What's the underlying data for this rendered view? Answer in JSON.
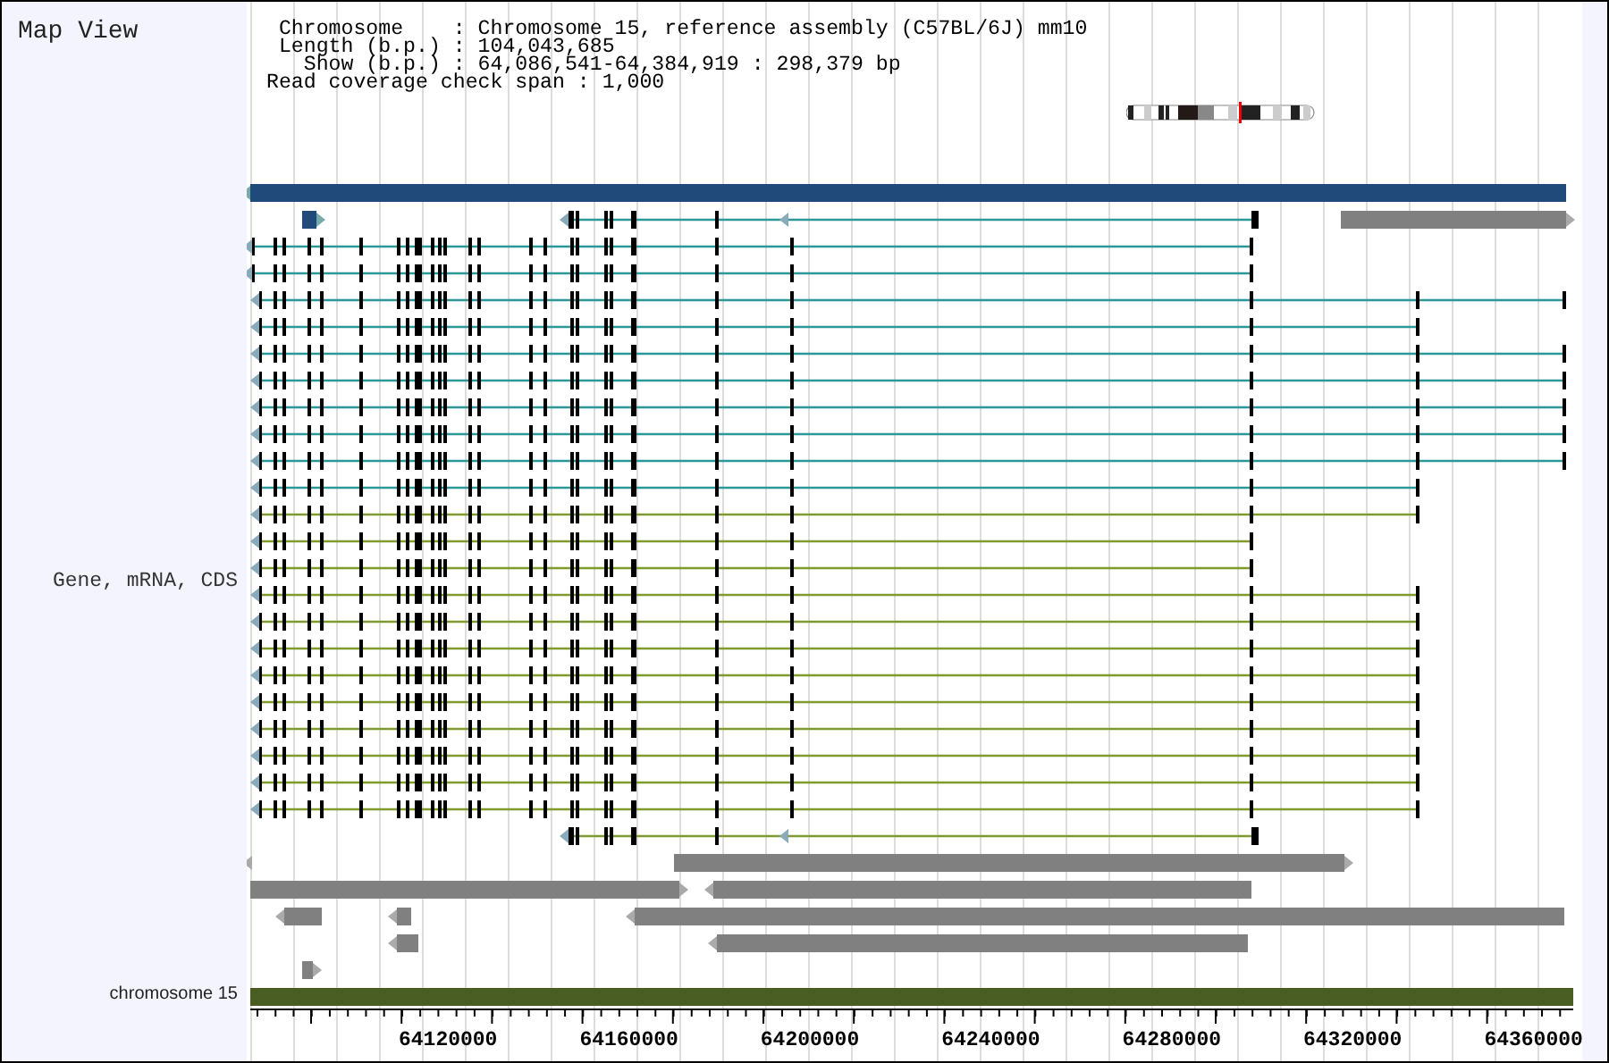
{
  "panel_title": "Map View",
  "info_lines": [
    " Chromosome    : Chromosome 15, reference assembly (C57BL/6J) mm10",
    " Length (b.p.) : 104,043,685",
    "   Show (b.p.) : 64,086,541-64,384,919 : 298,379 bp",
    "Read coverage check span : 1,000"
  ],
  "track_label": "Gene, mRNA, CDS",
  "transcripts": [
    {
      "kind": "short",
      "color": "#2f9696"
    },
    {
      "kind": "short",
      "color": "#2f9696"
    },
    {
      "kind": "long",
      "color": "#2f9696"
    },
    {
      "kind": "medium",
      "color": "#2f9696"
    },
    {
      "kind": "long",
      "color": "#2f9696"
    },
    {
      "kind": "long",
      "color": "#2f9696"
    },
    {
      "kind": "long",
      "color": "#2f9696"
    },
    {
      "kind": "long",
      "color": "#2f9696"
    },
    {
      "kind": "long",
      "color": "#2f9696"
    },
    {
      "kind": "medium",
      "color": "#2f9696"
    },
    {
      "kind": "medium",
      "color": "#7f9a2e"
    },
    {
      "kind": "short",
      "color": "#7f9a2e"
    },
    {
      "kind": "short",
      "color": "#7f9a2e"
    },
    {
      "kind": "medium",
      "color": "#7f9a2e"
    },
    {
      "kind": "medium",
      "color": "#7f9a2e"
    },
    {
      "kind": "medium",
      "color": "#7f9a2e"
    },
    {
      "kind": "medium",
      "color": "#7f9a2e"
    },
    {
      "kind": "medium",
      "color": "#7f9a2e"
    },
    {
      "kind": "medium",
      "color": "#7f9a2e"
    },
    {
      "kind": "medium",
      "color": "#7f9a2e"
    },
    {
      "kind": "medium",
      "color": "#7f9a2e"
    },
    {
      "kind": "medium",
      "color": "#7f9a2e"
    }
  ],
  "sequence_label": "chromosome 15",
  "axis_labels": [
    "64120000",
    "64160000",
    "64200000",
    "64240000",
    "64280000",
    "64320000",
    "64360000"
  ]
}
